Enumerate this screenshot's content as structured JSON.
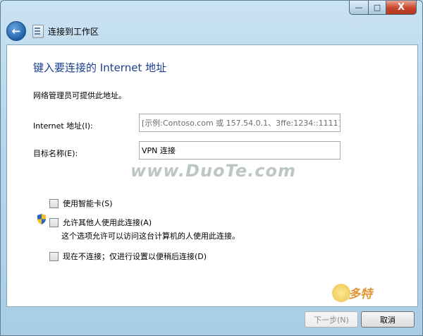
{
  "window": {
    "title": "连接到工作区",
    "controls": {
      "minimize": "—",
      "maximize": "□",
      "close": "X"
    }
  },
  "page": {
    "heading": "键入要连接的 Internet 地址",
    "description": "网络管理员可提供此地址。"
  },
  "form": {
    "address_label": "Internet 地址(I):",
    "address_placeholder": "[示例:Contoso.com 或 157.54.0.1、3ffe:1234::1111]",
    "destination_label": "目标名称(E):",
    "destination_value": "VPN 连接"
  },
  "options": {
    "smartcard": {
      "label": "使用智能卡(S)",
      "checked": false
    },
    "allow_others": {
      "label": "允许其他人使用此连接(A)",
      "checked": false,
      "description": "这个选项允许可以访问这台计算机的人使用此连接。"
    },
    "dont_connect": {
      "label": "现在不连接；仅进行设置以便稍后连接(D)",
      "checked": false
    }
  },
  "buttons": {
    "next": "下一步(N)",
    "cancel": "取消"
  },
  "watermark": {
    "main": "www.DuoTe.com",
    "logo": "多特"
  }
}
